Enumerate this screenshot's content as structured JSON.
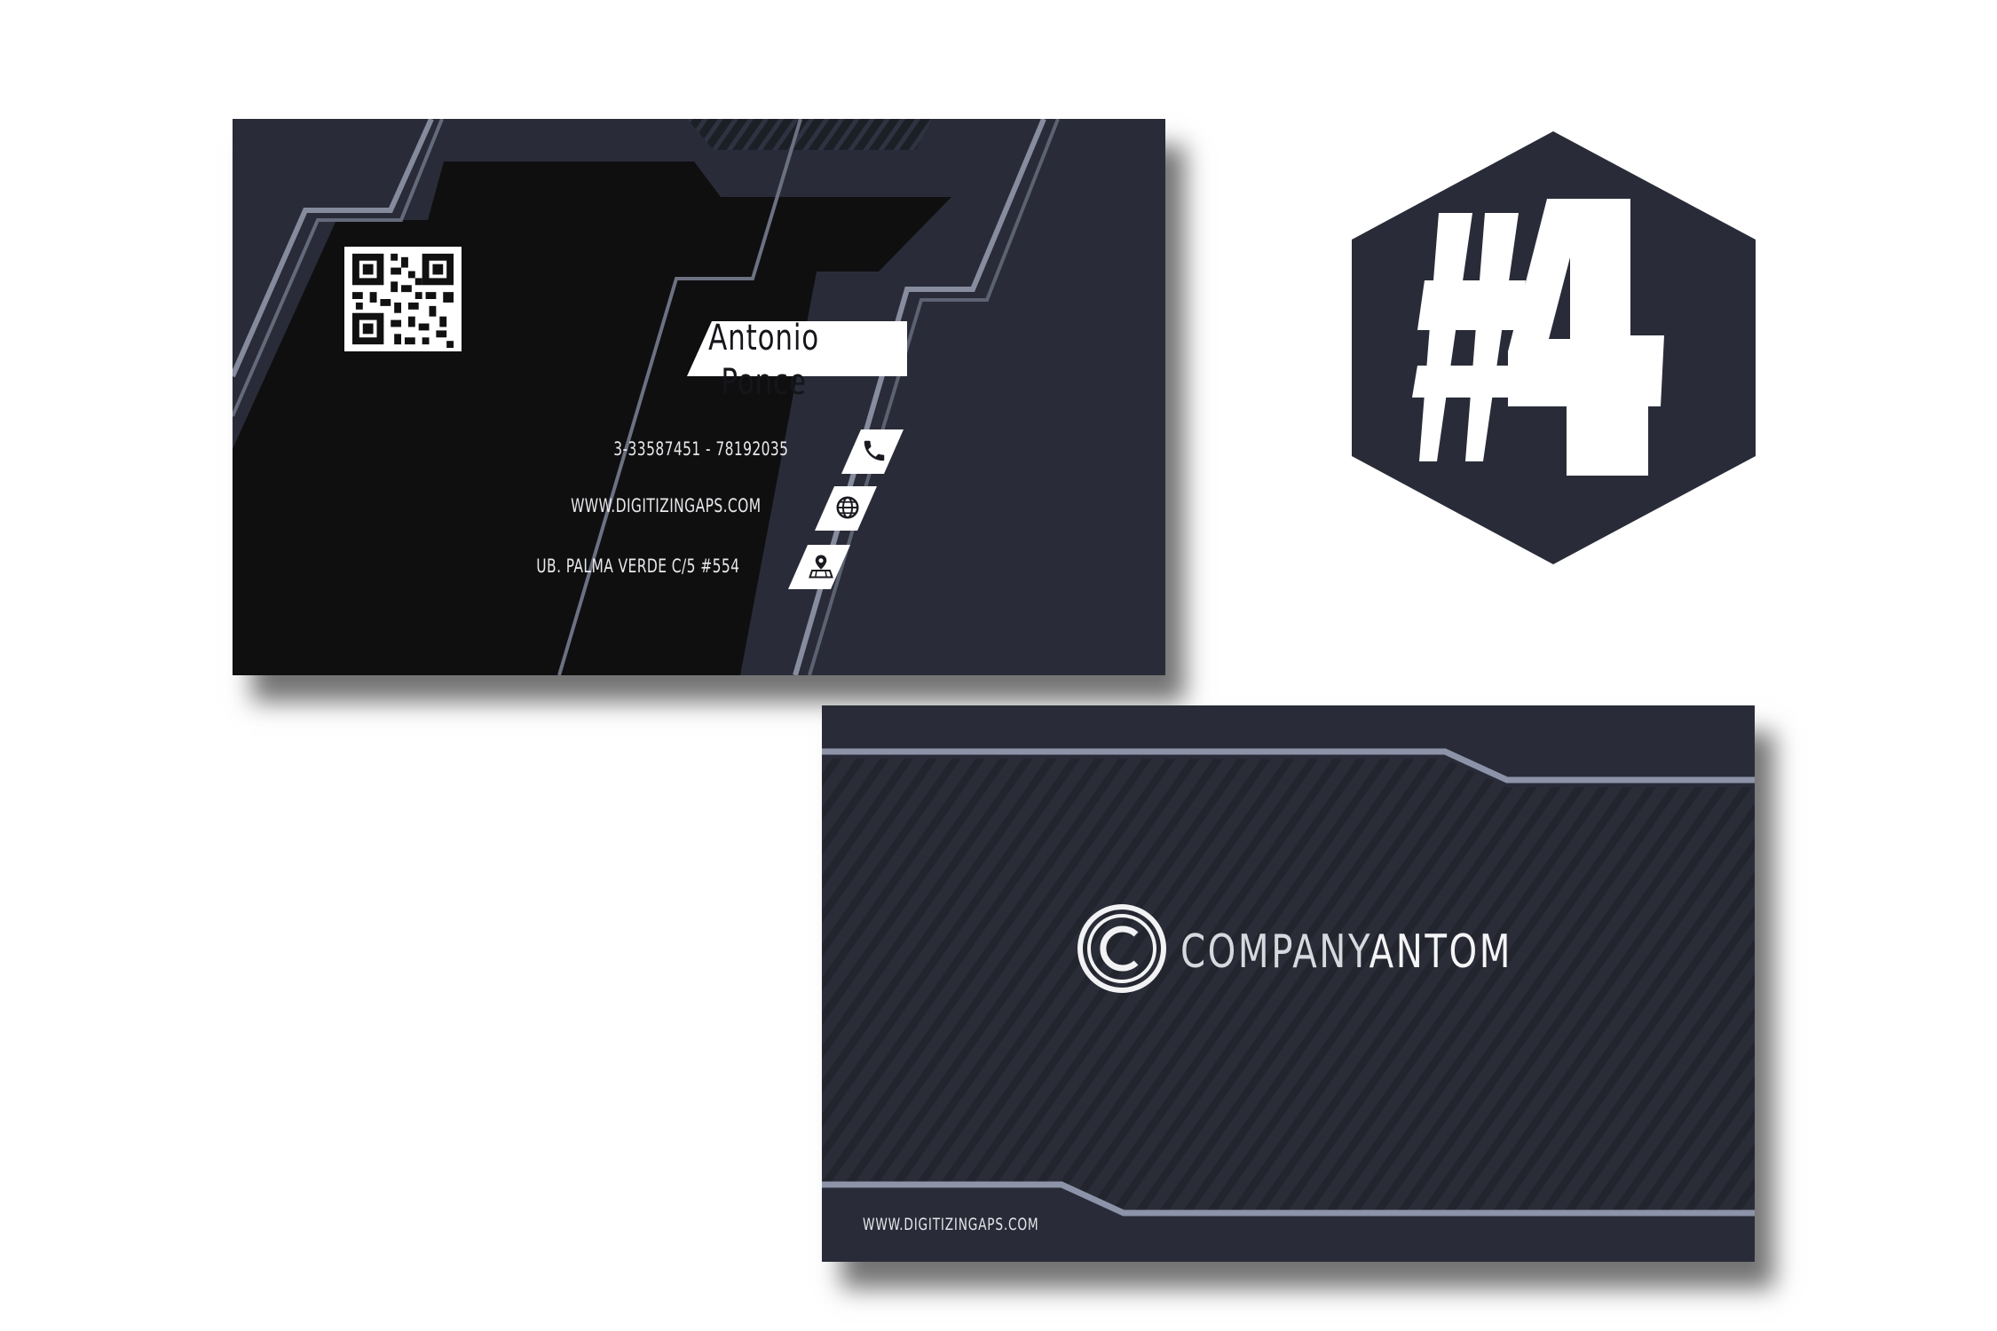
{
  "front": {
    "name": "Antonio Ponce",
    "phone": "3-33587451 - 78192035",
    "website": "WWW.DIGITIZINGAPS.COM",
    "address": "UB. PALMA VERDE C/5 #554",
    "icons": [
      "phone-icon",
      "globe-icon",
      "location-icon"
    ]
  },
  "back": {
    "brand_part1": "COMPANY",
    "brand_part2": "ANTOM",
    "website": "WWW.DIGITIZINGAPS.COM",
    "logo_icon": "copyright-icon"
  },
  "badge": {
    "text": "#4"
  },
  "colors": {
    "card": "#292c38",
    "panel": "#0f0f10",
    "stripe": "#808598",
    "white": "#ffffff"
  }
}
